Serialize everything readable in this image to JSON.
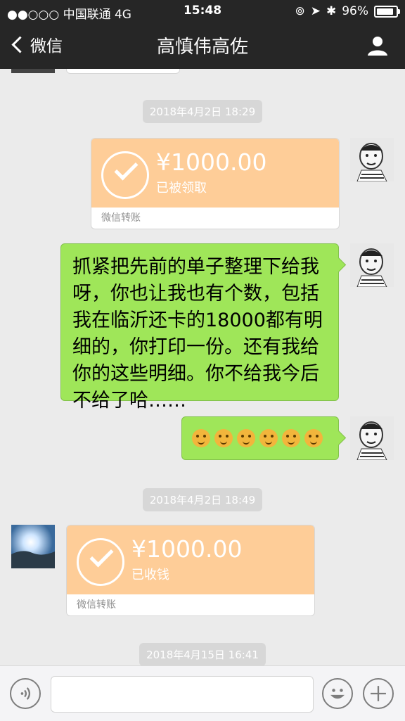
{
  "statusbar": {
    "signal": "●●○○○",
    "carrier": "中国联通",
    "network": "4G",
    "time": "15:48",
    "battery": "96%",
    "battery_level": 0.96
  },
  "navbar": {
    "back_label": "微信",
    "title": "高慎伟高佐"
  },
  "messages": {
    "stamp1": "2018年4月2日 18:29",
    "transfer1": {
      "amount": "¥1000.00",
      "status": "已被领取",
      "footer": "微信转账"
    },
    "text1": "抓紧把先前的单子整理下给我呀，你也让我也有个数，包括我在临沂还卡的18000都有明细的，你打印一份。还有我给你的这些明细。你不给我今后不给了哈……",
    "emoji_count": 6,
    "stamp2": "2018年4月2日 18:49",
    "transfer2": {
      "amount": "¥1000.00",
      "status": "已收钱",
      "footer": "微信转账"
    },
    "stamp3": "2018年4月15日 16:41"
  },
  "colors": {
    "topbar": "#262626",
    "bubble_green": "#9fe659",
    "transfer_orange": "#fecd98",
    "chat_bg": "#ebebeb"
  }
}
